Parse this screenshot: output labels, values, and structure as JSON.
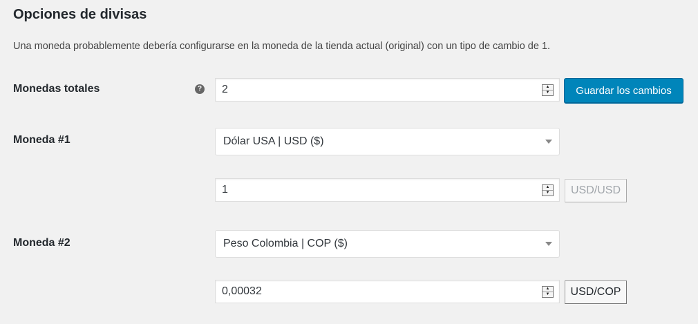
{
  "section": {
    "title": "Opciones de divisas",
    "description": "Una moneda probablemente debería configurarse en la moneda de la tienda actual (original) con un tipo de cambio de 1."
  },
  "total": {
    "label": "Monedas totales",
    "help_icon": "?",
    "value": "2",
    "save_label": "Guardar los cambios"
  },
  "currencies": [
    {
      "label": "Moneda #1",
      "selected": "Dólar USA | USD ($)",
      "rate": "1",
      "pair_label": "USD/USD"
    },
    {
      "label": "Moneda #2",
      "selected": "Peso Colombia | COP ($)",
      "rate": "0,00032",
      "pair_label": "USD/COP"
    }
  ],
  "colors": {
    "primary_button": "#0085ba",
    "background": "#f1f1f1"
  }
}
